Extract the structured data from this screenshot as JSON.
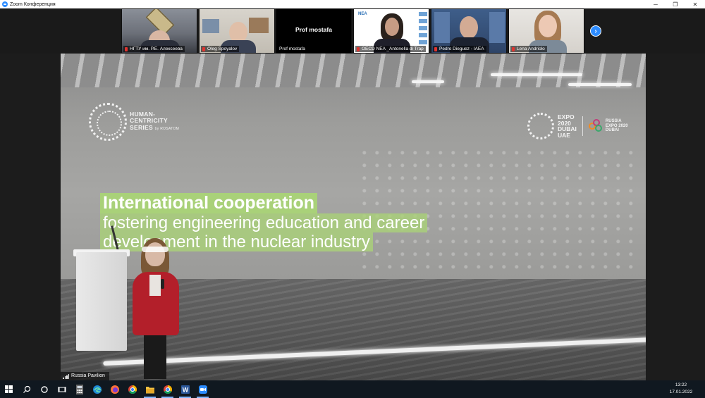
{
  "window": {
    "title": "Zoom Конференция",
    "controls": [
      "─",
      "❐",
      "✕"
    ]
  },
  "gallery": {
    "participants": [
      {
        "name": "НГТУ им. Р.Е. Алексеева",
        "muted": true
      },
      {
        "name": "Oleg Spoyalov",
        "muted": true
      },
      {
        "name": "Prof mostafa",
        "muted": false,
        "video_off": true,
        "display_name": "Prof mostafa"
      },
      {
        "name": "OECD NEA _Antonella di Trap",
        "muted": true
      },
      {
        "name": "Pedro Dieguez - IAEA",
        "muted": true
      },
      {
        "name": "Lena Andriolo",
        "muted": true
      }
    ],
    "next_page_icon": "chevron-right-icon"
  },
  "speaker": {
    "name": "Russia Pavilion",
    "slide": {
      "logo_left": [
        "HUMAN-",
        "CENTRICITY",
        "SERIES"
      ],
      "logo_left_small": "by ROSATOM",
      "expo_text": [
        "EXPO",
        "2020",
        "DUBAI",
        "UAE"
      ],
      "russia_text": [
        "RUSSIA",
        "EXPO 2020",
        "DUBAI"
      ],
      "title_line1": "International cooperation",
      "title_line2": "fostering engineering education and career",
      "title_line3": "development in the nuclear industry"
    }
  },
  "taskbar": {
    "items": [
      "start-icon",
      "search-icon",
      "cortana-icon",
      "task-view-icon",
      "calculator-icon",
      "edge-icon",
      "firefox-icon",
      "chrome-icon",
      "file-explorer-icon",
      "chrome-icon",
      "word-icon",
      "zoom-icon"
    ],
    "time": "13:22",
    "date": "17.01.2022"
  },
  "colors": {
    "zoom_blue": "#2d8cff",
    "slide_green": "#a9d179",
    "mute_red": "#e0342f",
    "jacket_red": "#b31f2a",
    "taskbar": "#101820"
  }
}
